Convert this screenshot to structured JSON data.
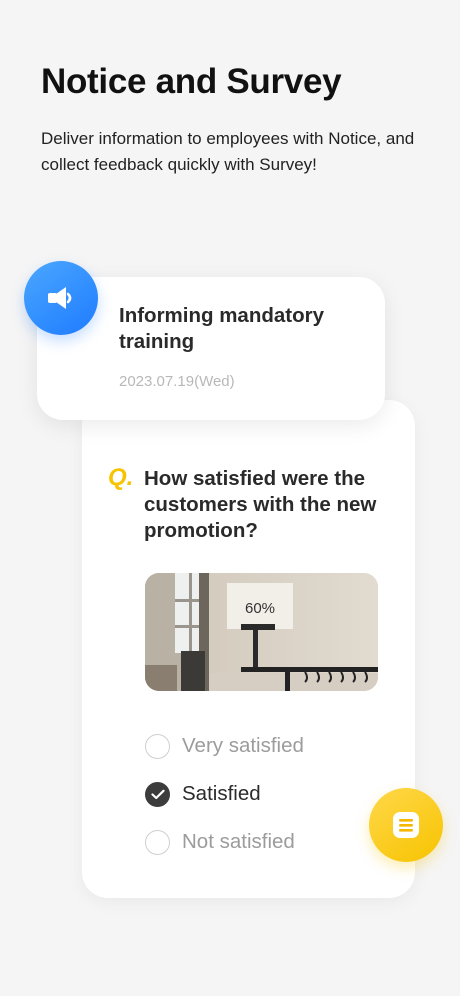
{
  "header": {
    "title": "Notice and Survey",
    "subtitle": "Deliver information to employees with Notice, and collect feedback quickly with Survey!"
  },
  "notice": {
    "title": "Informing mandatory training",
    "date": "2023.07.19(Wed)",
    "icon": "megaphone-icon"
  },
  "survey": {
    "q_mark": "Q.",
    "question": "How satisfied were the customers with the new promotion?",
    "image_sign_text": "60%",
    "options": [
      {
        "label": "Very satisfied",
        "selected": false
      },
      {
        "label": "Satisfied",
        "selected": true
      },
      {
        "label": "Not satisfied",
        "selected": false
      }
    ]
  },
  "floating": {
    "memo_icon": "memo-icon"
  },
  "colors": {
    "background": "#f5f5f5",
    "accent_blue": "#2b8cff",
    "accent_yellow": "#f7c300",
    "checked": "#3c3c3c"
  }
}
